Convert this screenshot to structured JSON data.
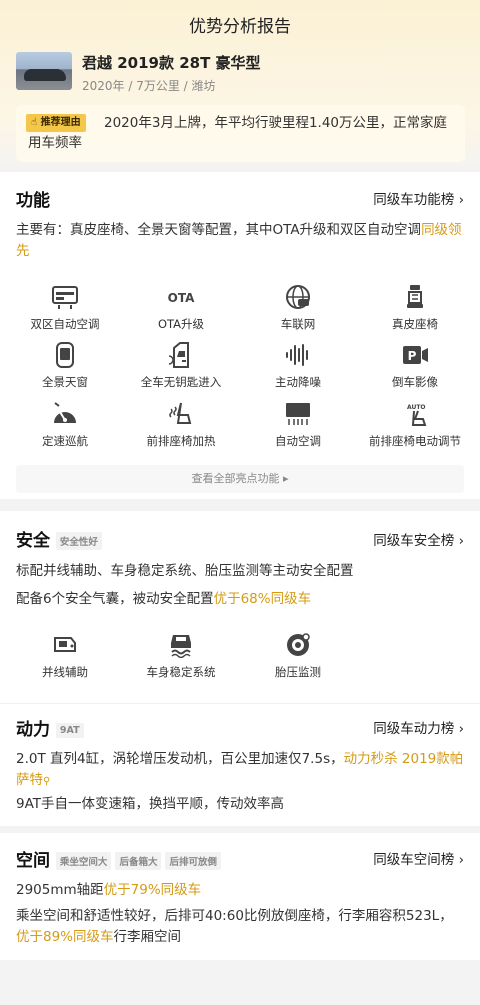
{
  "page_title": "优势分析报告",
  "car": {
    "name": "君越 2019款 28T 豪华型",
    "meta": "2020年 / 7万公里 / 潍坊"
  },
  "reason": {
    "tag": "推荐理由",
    "text": "2020年3月上牌，年平均行驶里程1.40万公里，正常家庭用车频率"
  },
  "features": {
    "title": "功能",
    "link": "同级车功能榜",
    "summary_plain": "主要有：真皮座椅、全景天窗等配置，其中OTA升级和双区自动空调",
    "summary_hl": "同级领先",
    "items": [
      {
        "label": "双区自动空调",
        "icon": "climate-control-icon"
      },
      {
        "label": "OTA升级",
        "icon": "ota-icon"
      },
      {
        "label": "车联网",
        "icon": "connected-car-icon"
      },
      {
        "label": "真皮座椅",
        "icon": "leather-seat-icon"
      },
      {
        "label": "全景天窗",
        "icon": "panoramic-sunroof-icon"
      },
      {
        "label": "全车无钥匙进入",
        "icon": "keyless-entry-icon"
      },
      {
        "label": "主动降噪",
        "icon": "noise-cancel-icon"
      },
      {
        "label": "倒车影像",
        "icon": "reverse-camera-icon"
      },
      {
        "label": "定速巡航",
        "icon": "cruise-control-icon"
      },
      {
        "label": "前排座椅加热",
        "icon": "seat-heating-icon"
      },
      {
        "label": "自动空调",
        "icon": "auto-ac-icon"
      },
      {
        "label": "前排座椅电动调节",
        "icon": "power-seat-icon"
      }
    ],
    "view_all": "查看全部亮点功能"
  },
  "safety": {
    "title": "安全",
    "chip": "安全性好",
    "link": "同级车安全榜",
    "line1": "标配并线辅助、车身稳定系统、胎压监测等主动安全配置",
    "line2_plain": "配备6个安全气囊，被动安全配置",
    "line2_hl": "优于68%同级车",
    "items": [
      {
        "label": "并线辅助",
        "icon": "lane-assist-icon"
      },
      {
        "label": "车身稳定系统",
        "icon": "stability-control-icon"
      },
      {
        "label": "胎压监测",
        "icon": "tire-pressure-icon"
      }
    ]
  },
  "power": {
    "title": "动力",
    "chip": "9AT",
    "link": "同级车动力榜",
    "line1_plain": "2.0T 直列4缸，涡轮增压发动机，百公里加速仅7.5s，",
    "line1_hl": "动力秒杀 2019款帕萨特",
    "line2": "9AT手自一体变速箱，换挡平顺，传动效率高"
  },
  "space": {
    "title": "空间",
    "chips": [
      "乘坐空间大",
      "后备箱大",
      "后排可放倒"
    ],
    "link": "同级车空间榜",
    "line1_plain": "2905mm轴距",
    "line1_hl": "优于79%同级车",
    "line2_plain": "乘坐空间和舒适性较好，后排可40:60比例放倒座椅，行李厢容积523L，",
    "line2_hl": "优于89%同级车",
    "line2_tail": "行李厢空间"
  }
}
